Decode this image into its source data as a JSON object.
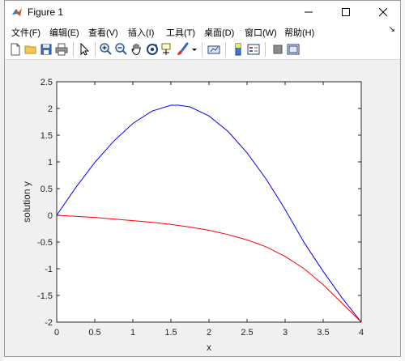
{
  "window": {
    "title": "Figure 1",
    "controls": {
      "minimize": "—",
      "maximize": "☐",
      "close": "✕"
    }
  },
  "menubar": {
    "items": [
      {
        "label": "文件(F)"
      },
      {
        "label": "编辑(E)"
      },
      {
        "label": "查看(V)"
      },
      {
        "label": "插入(I)"
      },
      {
        "label": "工具(T)"
      },
      {
        "label": "桌面(D)"
      },
      {
        "label": "窗口(W)"
      },
      {
        "label": "帮助(H)"
      }
    ],
    "overflow_arrow": "↘"
  },
  "toolbar": {
    "icons": [
      "new-figure-icon",
      "open-file-icon",
      "save-icon",
      "print-icon",
      "edit-pointer-icon",
      "zoom-in-icon",
      "zoom-out-icon",
      "pan-hand-icon",
      "rotate-3d-icon",
      "data-cursor-icon",
      "brush-icon",
      "brush-dropdown-icon",
      "link-plot-icon",
      "colorbar-icon",
      "legend-icon",
      "hide-plot-tools-icon",
      "show-plot-tools-icon"
    ]
  },
  "chart_data": {
    "type": "line",
    "title": "",
    "xlabel": "x",
    "ylabel": "solution y",
    "xlim": [
      0,
      4
    ],
    "ylim": [
      -2,
      2.5
    ],
    "xticks": [
      "0",
      "0.5",
      "1",
      "1.5",
      "2",
      "2.5",
      "3",
      "3.5",
      "4"
    ],
    "yticks": [
      "-2",
      "-1.5",
      "-1",
      "-0.5",
      "0",
      "0.5",
      "1",
      "1.5",
      "2",
      "2.5"
    ],
    "grid": false,
    "series": [
      {
        "color": "#0000ff",
        "x": [
          0,
          0.25,
          0.5,
          0.75,
          1.0,
          1.25,
          1.5,
          1.6,
          1.75,
          2.0,
          2.25,
          2.5,
          2.75,
          3.0,
          3.25,
          3.5,
          3.75,
          4.0
        ],
        "y": [
          0,
          0.52,
          0.99,
          1.39,
          1.72,
          1.95,
          2.06,
          2.06,
          2.03,
          1.86,
          1.57,
          1.17,
          0.68,
          0.11,
          -0.51,
          -1.05,
          -1.55,
          -2.0
        ]
      },
      {
        "color": "#ff0000",
        "x": [
          0,
          0.25,
          0.5,
          0.75,
          1.0,
          1.25,
          1.5,
          1.75,
          2.0,
          2.25,
          2.5,
          2.75,
          3.0,
          3.25,
          3.5,
          3.75,
          4.0
        ],
        "y": [
          0,
          -0.02,
          -0.04,
          -0.07,
          -0.1,
          -0.13,
          -0.17,
          -0.22,
          -0.28,
          -0.36,
          -0.46,
          -0.59,
          -0.77,
          -1.0,
          -1.3,
          -1.65,
          -2.0
        ]
      }
    ]
  }
}
